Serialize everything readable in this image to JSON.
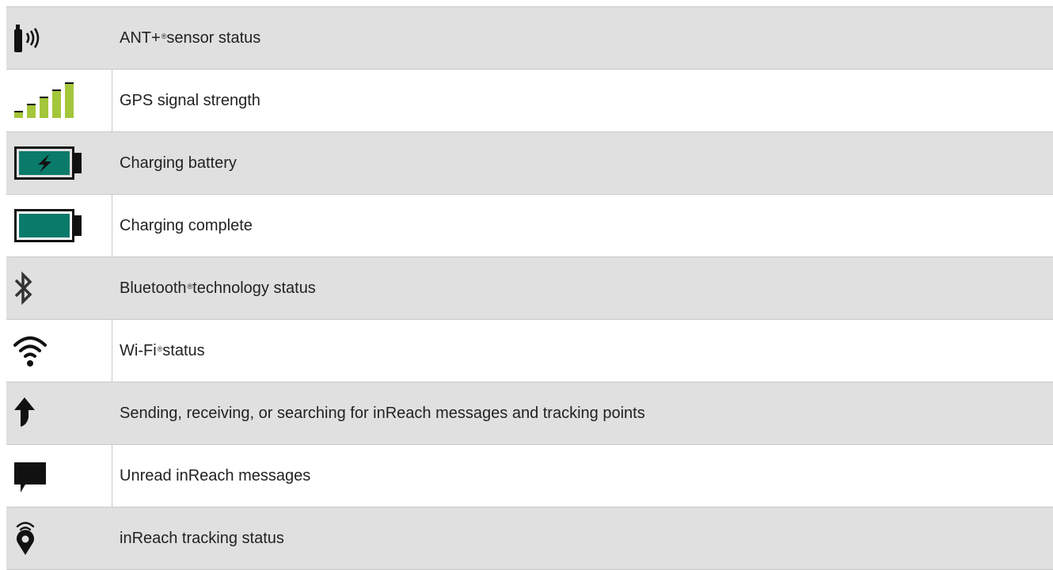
{
  "rows": [
    {
      "icon": "ant-sensor-icon",
      "text": "ANT+",
      "sup": "®",
      "rest": " sensor status"
    },
    {
      "icon": "gps-signal-icon",
      "text": "GPS signal strength"
    },
    {
      "icon": "charging-battery-icon",
      "text": "Charging battery"
    },
    {
      "icon": "full-battery-icon",
      "text": "Charging complete"
    },
    {
      "icon": "bluetooth-icon",
      "text": "Bluetooth",
      "sup": "®",
      "rest": " technology status"
    },
    {
      "icon": "wifi-icon",
      "text": "Wi-Fi",
      "sup": "®",
      "rest": " status"
    },
    {
      "icon": "arrow-up-icon",
      "text": "Sending, receiving, or searching for inReach messages and tracking points"
    },
    {
      "icon": "message-icon",
      "text": "Unread inReach messages"
    },
    {
      "icon": "tracking-pin-icon",
      "text": "inReach tracking status"
    }
  ],
  "colors": {
    "shade": "#e0e0e0",
    "gps_green": "#a4c63a",
    "battery_teal": "#0a7a6a"
  }
}
